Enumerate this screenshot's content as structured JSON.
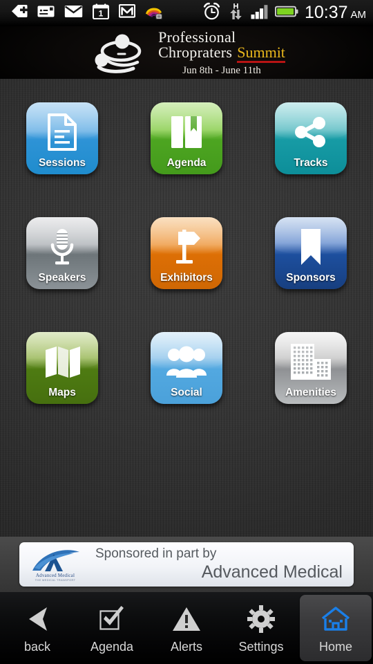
{
  "status_bar": {
    "left_icons": [
      {
        "name": "download-tag-icon",
        "glyph": "tag"
      },
      {
        "name": "mms-card-icon",
        "glyph": "card"
      },
      {
        "name": "mail-envelope-icon",
        "glyph": "envelope"
      },
      {
        "name": "calendar-icon",
        "glyph": "calendar",
        "day": "1"
      },
      {
        "name": "gmail-icon",
        "glyph": "gmail"
      },
      {
        "name": "media-rainbow-icon",
        "glyph": "rainbow"
      }
    ],
    "right_icons": [
      {
        "name": "alarm-clock-icon",
        "glyph": "alarm"
      },
      {
        "name": "hspa-data-icon",
        "glyph": "hspa",
        "letter": "H"
      },
      {
        "name": "signal-bars-icon",
        "glyph": "signal",
        "bars_filled": 3,
        "bars_total": 4
      },
      {
        "name": "battery-icon",
        "glyph": "battery",
        "level": 90,
        "color": "#7ed321"
      }
    ],
    "time": "10:37",
    "meridiem": "AM"
  },
  "header": {
    "line1": "Professional",
    "line2": "Chropraters",
    "line2_highlight": "Summit",
    "dates": "Jun 8th - June 11th",
    "highlight_color": "#e8b71c",
    "underline_color": "#b81414",
    "logo_icon": "chiropractic-patient-logo"
  },
  "grid": {
    "tiles": [
      {
        "label": "Sessions",
        "icon": "document-icon",
        "theme": "t-blue",
        "name": "tile-sessions",
        "color": "#2e93d6"
      },
      {
        "label": "Agenda",
        "icon": "book-icon",
        "theme": "t-green",
        "name": "tile-agenda",
        "color": "#4da521"
      },
      {
        "label": "Tracks",
        "icon": "share-nodes-icon",
        "theme": "t-teal",
        "name": "tile-tracks",
        "color": "#179ba5"
      },
      {
        "label": "Speakers",
        "icon": "microphone-icon",
        "theme": "t-silver",
        "name": "tile-speakers",
        "color": "#6d7579"
      },
      {
        "label": "Exhibitors",
        "icon": "signpost-icon",
        "theme": "t-orange",
        "name": "tile-exhibitors",
        "color": "#dd6f05"
      },
      {
        "label": "Sponsors",
        "icon": "ribbon-icon",
        "theme": "t-navy",
        "name": "tile-sponsors",
        "color": "#1d4f9e"
      },
      {
        "label": "Maps",
        "icon": "folded-map-icon",
        "theme": "t-olive",
        "name": "tile-maps",
        "color": "#4e7b12"
      },
      {
        "label": "Social",
        "icon": "people-group-icon",
        "theme": "t-ltblue",
        "name": "tile-social",
        "color": "#52a8e0"
      },
      {
        "label": "Amenities",
        "icon": "buildings-icon",
        "theme": "t-gray",
        "name": "tile-amenities",
        "color": "#8f9194"
      }
    ]
  },
  "sponsor_banner": {
    "line1": "Sponsored in part by",
    "line2": "Advanced Medical",
    "logo_name": "Advanced Medical",
    "logo_tagline": "THE MEDICAL TRANSPORT",
    "logo_icon": "advanced-medical-swoosh-logo"
  },
  "bottom_nav": {
    "items": [
      {
        "label": "back",
        "icon": "back-arrow-icon",
        "name": "nav-back",
        "active": false
      },
      {
        "label": "Agenda",
        "icon": "checkbox-check-icon",
        "name": "nav-agenda",
        "active": false
      },
      {
        "label": "Alerts",
        "icon": "warning-triangle-icon",
        "name": "nav-alerts",
        "active": false
      },
      {
        "label": "Settings",
        "icon": "gear-icon",
        "name": "nav-settings",
        "active": false
      },
      {
        "label": "Home",
        "icon": "home-house-icon",
        "name": "nav-home",
        "active": true
      }
    ],
    "active_icon_color": "#1a7fe8"
  }
}
